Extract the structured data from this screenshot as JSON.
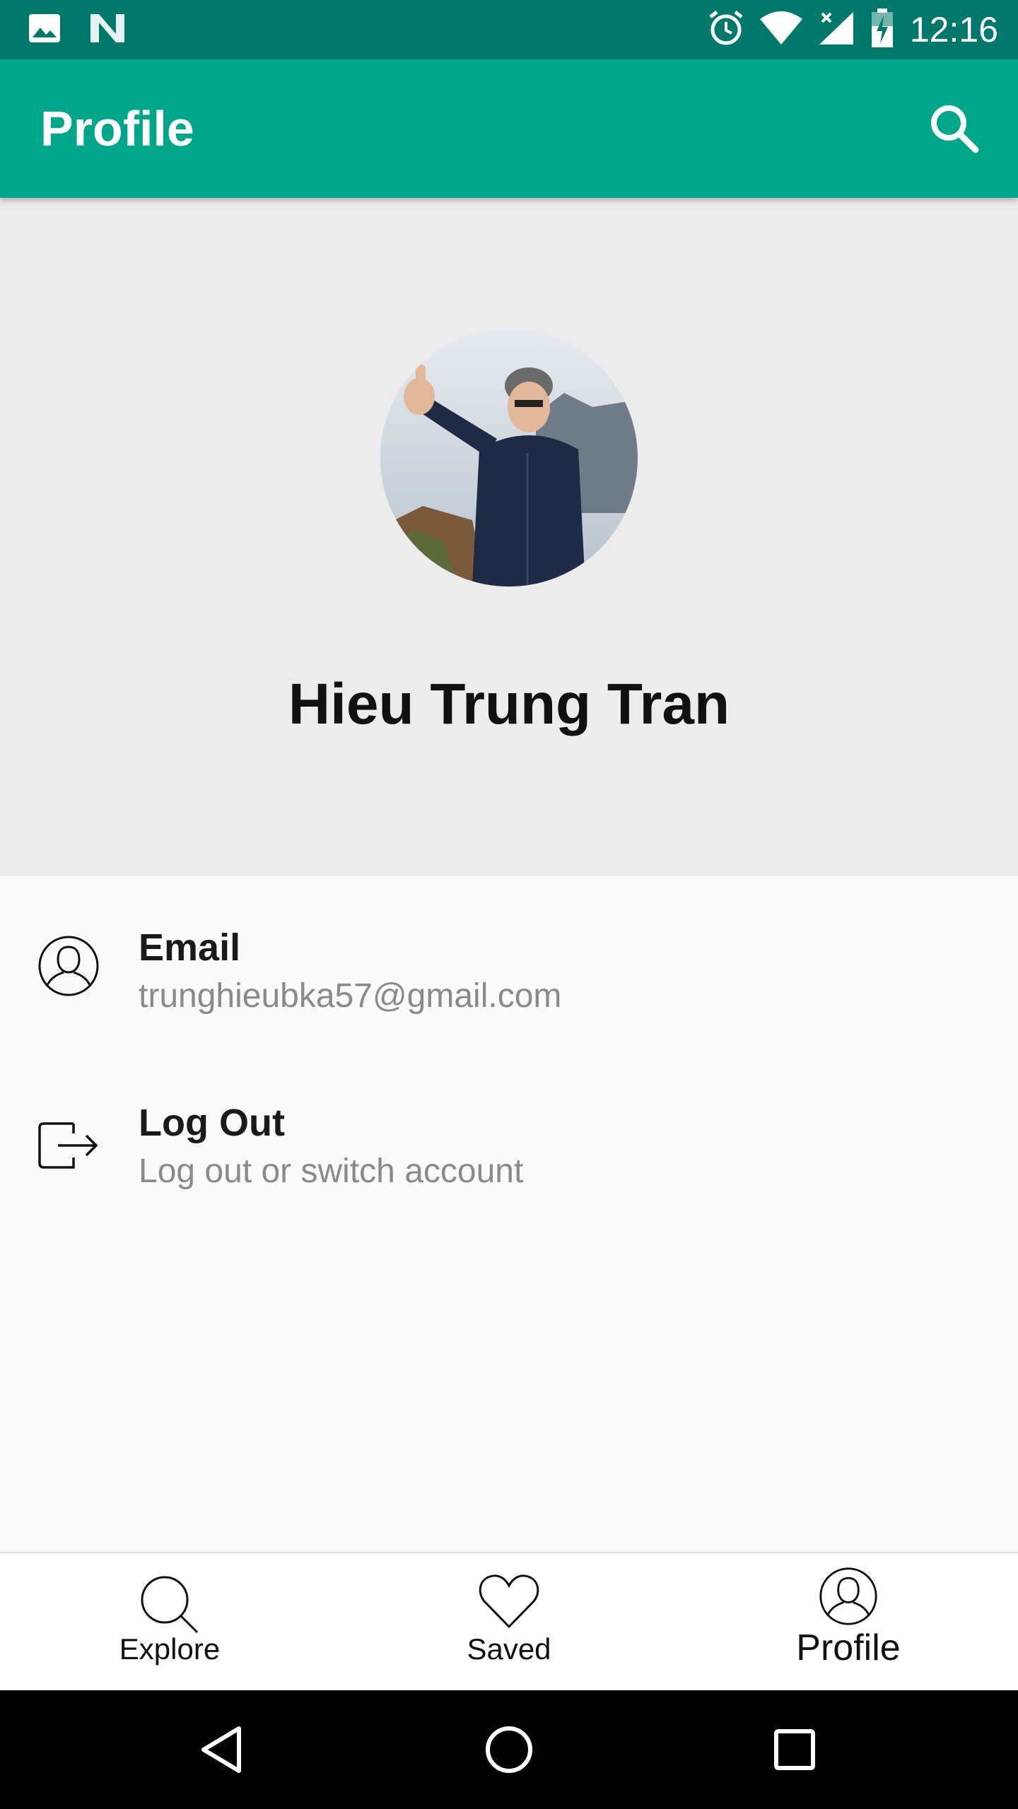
{
  "status_bar": {
    "time": "12:16",
    "icons": [
      "image-icon",
      "n-icon",
      "alarm-icon",
      "wifi-icon",
      "signal-icon",
      "battery-icon"
    ]
  },
  "app_bar": {
    "title": "Profile",
    "search_icon": "search-icon",
    "background": "#00a688"
  },
  "profile": {
    "name": "Hieu Trung Tran"
  },
  "rows": [
    {
      "label": "Email",
      "sub": "trunghieubka57@gmail.com",
      "icon": "person-circle-icon"
    },
    {
      "label": "Log Out",
      "sub": "Log out or switch account",
      "icon": "logout-icon"
    }
  ],
  "bottom_nav": {
    "items": [
      {
        "label": "Explore",
        "icon": "search-icon"
      },
      {
        "label": "Saved",
        "icon": "heart-icon"
      },
      {
        "label": "Profile",
        "icon": "person-circle-icon",
        "active": true
      }
    ]
  },
  "system_nav": [
    "back-icon",
    "home-icon",
    "recents-icon"
  ],
  "colors": {
    "status": "#00796b",
    "accent": "#00a688",
    "hero_bg": "#ececec"
  }
}
